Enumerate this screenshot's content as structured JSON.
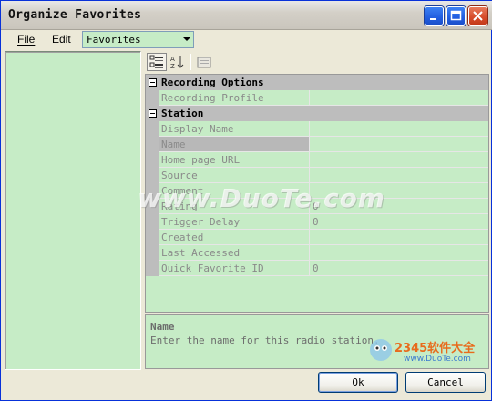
{
  "window": {
    "title": "Organize Favorites"
  },
  "menu": {
    "file_label": "File",
    "edit_label": "Edit",
    "view_select": {
      "value": "Favorites"
    }
  },
  "property_grid": {
    "categories": [
      {
        "label": "Recording Options",
        "properties": [
          {
            "name": "Recording Profile",
            "value": ""
          }
        ]
      },
      {
        "label": "Station",
        "properties": [
          {
            "name": "Display Name",
            "value": ""
          },
          {
            "name": "Name",
            "value": ""
          },
          {
            "name": "Home page URL",
            "value": ""
          },
          {
            "name": "Source",
            "value": ""
          },
          {
            "name": "Comment",
            "value": ""
          },
          {
            "name": "Rating",
            "value": "0"
          },
          {
            "name": "Trigger Delay",
            "value": "0"
          },
          {
            "name": "Created",
            "value": ""
          },
          {
            "name": "Last Accessed",
            "value": ""
          },
          {
            "name": "Quick Favorite ID",
            "value": "0"
          }
        ]
      }
    ],
    "selected_property": "Name"
  },
  "description": {
    "title": "Name",
    "text": "Enter the name for this radio station."
  },
  "buttons": {
    "ok": "Ok",
    "cancel": "Cancel"
  },
  "watermarks": {
    "main": "www.DuoTe.com",
    "corner_brand": "2345软件大全",
    "corner_url": "www.DuoTe.com"
  },
  "colors": {
    "pane_bg": "#c6ecc6",
    "window_bg": "#ece9d8",
    "titlebar_blue": "#225ee0",
    "close_red": "#d64b2a"
  }
}
